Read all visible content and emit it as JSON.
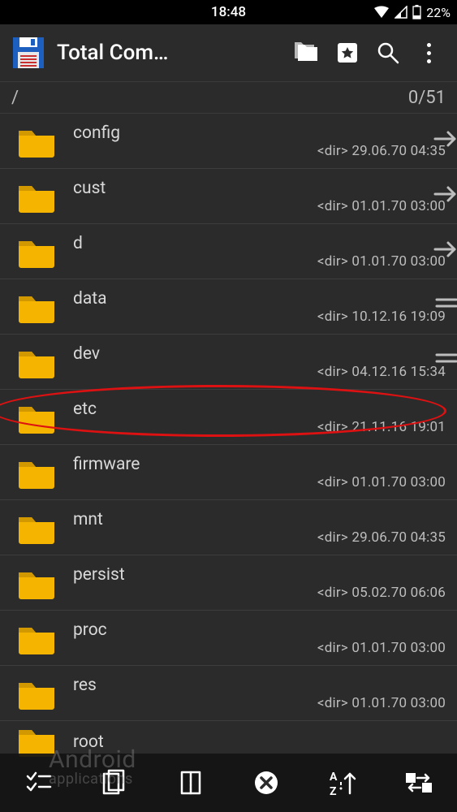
{
  "status": {
    "time": "18:48",
    "battery_pct": "22%"
  },
  "appbar": {
    "title": "Total Com…"
  },
  "path": {
    "current": "/",
    "counter": "0/51"
  },
  "rows": [
    {
      "name": "config",
      "type": "<dir>",
      "date": "29.06.70",
      "time": "04:35",
      "side": "arrow"
    },
    {
      "name": "cust",
      "type": "<dir>",
      "date": "01.01.70",
      "time": "03:00",
      "side": "arrow"
    },
    {
      "name": "d",
      "type": "<dir>",
      "date": "01.01.70",
      "time": "03:00",
      "side": "arrow"
    },
    {
      "name": "data",
      "type": "<dir>",
      "date": "10.12.16",
      "time": "19:09",
      "side": "eq"
    },
    {
      "name": "dev",
      "type": "<dir>",
      "date": "04.12.16",
      "time": "15:34",
      "side": "eq"
    },
    {
      "name": "etc",
      "type": "<dir>",
      "date": "21.11.16",
      "time": "19:01",
      "highlight": true
    },
    {
      "name": "firmware",
      "type": "<dir>",
      "date": "01.01.70",
      "time": "03:00"
    },
    {
      "name": "mnt",
      "type": "<dir>",
      "date": "29.06.70",
      "time": "04:35"
    },
    {
      "name": "persist",
      "type": "<dir>",
      "date": "05.02.70",
      "time": "06:06"
    },
    {
      "name": "proc",
      "type": "<dir>",
      "date": "01.01.70",
      "time": "03:00"
    },
    {
      "name": "res",
      "type": "<dir>",
      "date": "01.01.70",
      "time": "03:00"
    },
    {
      "name": "root",
      "type": "",
      "date": "",
      "time": "",
      "last": true
    }
  ],
  "watermark": {
    "line1": "Android",
    "line2": "applications"
  }
}
